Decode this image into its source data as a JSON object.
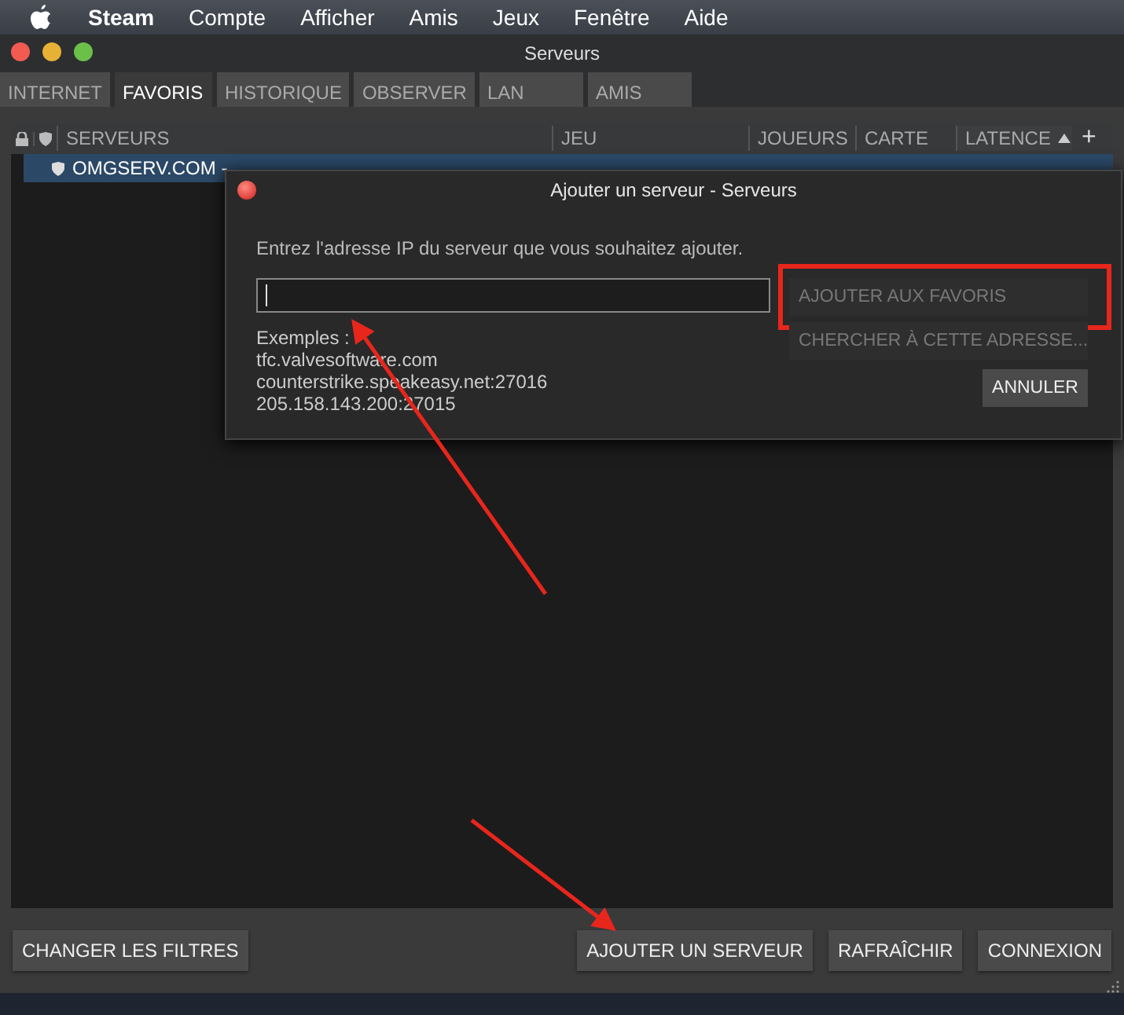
{
  "menu_bar": {
    "app_name": "Steam",
    "items": [
      "Compte",
      "Afficher",
      "Amis",
      "Jeux",
      "Fenêtre",
      "Aide"
    ]
  },
  "window": {
    "title": "Serveurs"
  },
  "tabs": [
    {
      "label": "INTERNET",
      "selected": false
    },
    {
      "label": "FAVORIS",
      "selected": true
    },
    {
      "label": "HISTORIQUE",
      "selected": false
    },
    {
      "label": "OBSERVER",
      "selected": false
    },
    {
      "label": "LAN",
      "selected": false
    },
    {
      "label": "AMIS",
      "selected": false
    }
  ],
  "table": {
    "columns": [
      {
        "label": "SERVEURS",
        "sorted": false
      },
      {
        "label": "JEU",
        "sorted": false
      },
      {
        "label": "JOUEURS",
        "sorted": false
      },
      {
        "label": "CARTE",
        "sorted": false
      },
      {
        "label": "LATENCE",
        "sorted": true
      }
    ],
    "add_button": "+",
    "rows": [
      {
        "name": "OMGSERV.COM -",
        "selected": true
      }
    ]
  },
  "dialog": {
    "title": "Ajouter un serveur - Serveurs",
    "prompt": "Entrez l'adresse IP du serveur que vous souhaitez ajouter.",
    "examples_label": "Exemples :",
    "examples": [
      "tfc.valvesoftware.com",
      "counterstrike.speakeasy.net:27016",
      "205.158.143.200:27015"
    ],
    "buttons": [
      {
        "label": "AJOUTER AUX FAVORIS",
        "disabled": true,
        "highlighted": true
      },
      {
        "label": "CHERCHER À CETTE ADRESSE...",
        "disabled": true,
        "highlighted": false
      },
      {
        "label": "ANNULER",
        "disabled": false,
        "highlighted": false
      }
    ]
  },
  "bottom_bar": {
    "left_button": "CHANGER LES FILTRES",
    "right_buttons": [
      "AJOUTER UN SERVEUR",
      "RAFRAÎCHIR",
      "CONNEXION"
    ]
  }
}
